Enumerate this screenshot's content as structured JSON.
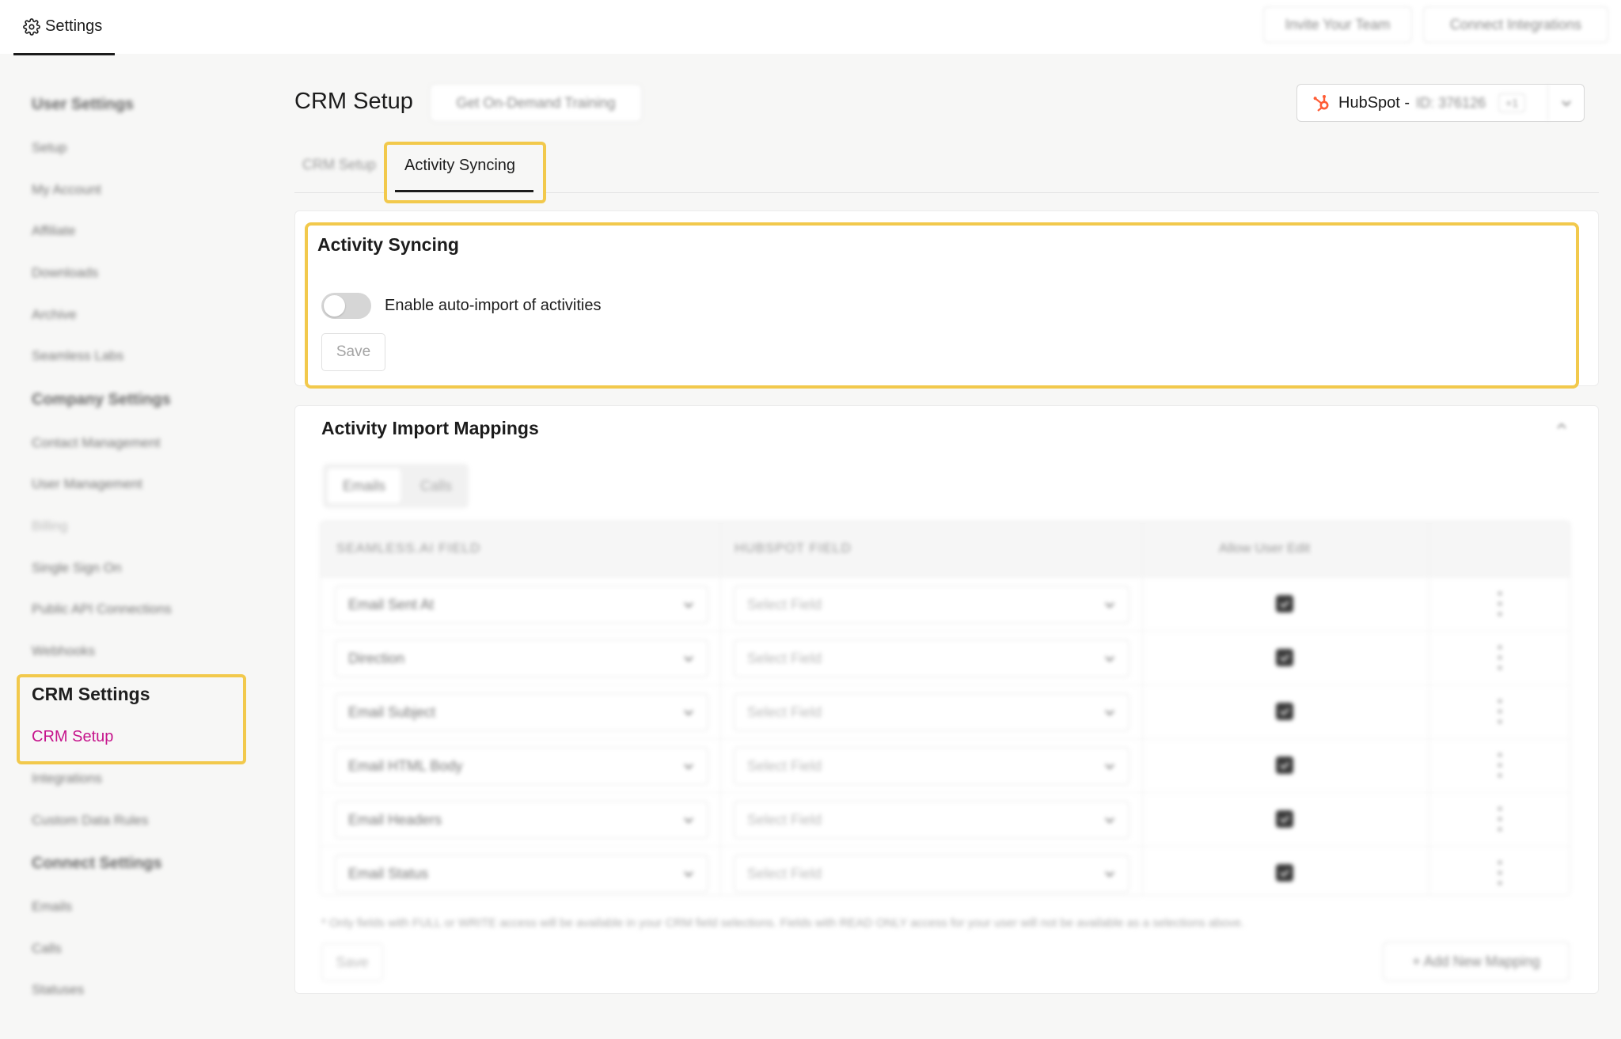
{
  "topbar": {
    "settings_label": "Settings",
    "invite_label": "Invite Your Team",
    "connect_label": "Connect Integrations"
  },
  "sidebar": {
    "user_settings_heading": "User Settings",
    "user_items": [
      "Setup",
      "My Account",
      "Affiliate",
      "Downloads",
      "Archive",
      "Seamless Labs"
    ],
    "company_settings_heading": "Company Settings",
    "company_items": [
      "Contact Management",
      "User Management",
      "Billing",
      "Single Sign On",
      "Public API Connections",
      "Webhooks"
    ],
    "crm_settings_heading": "CRM Settings",
    "crm_items": [
      "CRM Setup",
      "Integrations",
      "Custom Data Rules"
    ],
    "connect_settings_heading": "Connect Settings",
    "connect_items": [
      "Emails",
      "Calls",
      "Statuses"
    ]
  },
  "header": {
    "title": "CRM Setup",
    "training_label": "Get On-Demand Training",
    "hubspot_name": "HubSpot -",
    "hubspot_id": "ID: 376126",
    "hubspot_extra": "+1"
  },
  "tabs": {
    "crm_setup": "CRM Setup",
    "activity_syncing": "Activity Syncing"
  },
  "activity_card": {
    "title": "Activity Syncing",
    "toggle_label": "Enable auto-import of activities",
    "toggle_on": false,
    "save_label": "Save"
  },
  "mappings": {
    "title": "Activity Import Mappings",
    "segments": [
      "Emails",
      "Calls"
    ],
    "columns": [
      "SEAMLESS.AI FIELD",
      "HUBSPOT FIELD",
      "Allow User Edit"
    ],
    "rows": [
      {
        "seamless_field": "Email Sent At",
        "hubspot_field": "Select Field",
        "allow_edit": true
      },
      {
        "seamless_field": "Direction",
        "hubspot_field": "Select Field",
        "allow_edit": true
      },
      {
        "seamless_field": "Email Subject",
        "hubspot_field": "Select Field",
        "allow_edit": true
      },
      {
        "seamless_field": "Email HTML Body",
        "hubspot_field": "Select Field",
        "allow_edit": true
      },
      {
        "seamless_field": "Email Headers",
        "hubspot_field": "Select Field",
        "allow_edit": true
      },
      {
        "seamless_field": "Email Status",
        "hubspot_field": "Select Field",
        "allow_edit": true
      }
    ],
    "footnote": "* Only fields with FULL or WRITE access will be available in your CRM field selections. Fields with READ ONLY access for your user will not be available as a selections above.",
    "save_label": "Save",
    "add_label": "+ Add New Mapping"
  },
  "colors": {
    "highlight": "#f2c94c",
    "active_link": "#c6158c",
    "hubspot": "#ff5c35"
  }
}
